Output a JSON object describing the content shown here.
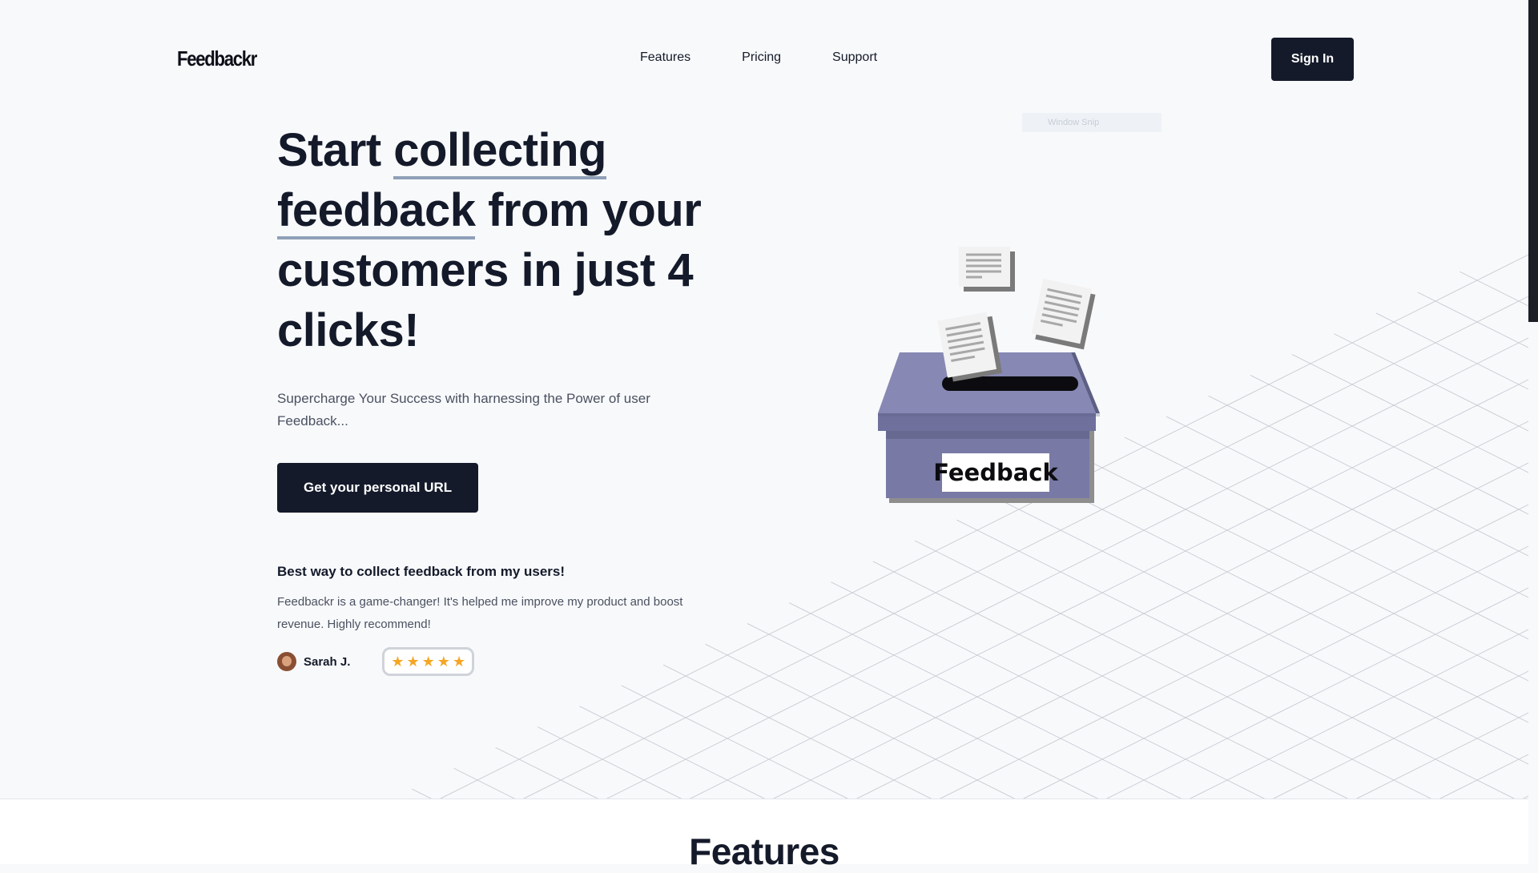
{
  "header": {
    "logo": "Feedbackr",
    "nav": [
      "Features",
      "Pricing",
      "Support"
    ],
    "signin_label": "Sign In"
  },
  "hero": {
    "headline": {
      "part1": "Start ",
      "underlined1": "collecting",
      "underlined2": "feedback",
      "part2": " from your customers in just 4 clicks!"
    },
    "subtitle": "Supercharge Your Success with harnessing the Power of user Feedback...",
    "cta_label": "Get your personal URL"
  },
  "testimonial": {
    "title": "Best way to collect feedback from my users!",
    "text": "Feedbackr is a game-changer! It's helped me improve my product and boost revenue. Highly recommend!",
    "author": "Sarah J.",
    "rating": 5,
    "stars": [
      "★",
      "★",
      "★",
      "★",
      "★"
    ]
  },
  "snip_label": "Window Snip",
  "illustration": {
    "box_label": "Feedback"
  },
  "features": {
    "title": "Features"
  },
  "colors": {
    "primary": "#141a2a",
    "underline": "#8fa0b8",
    "box": "#7879a4",
    "star": "#f5a623"
  }
}
